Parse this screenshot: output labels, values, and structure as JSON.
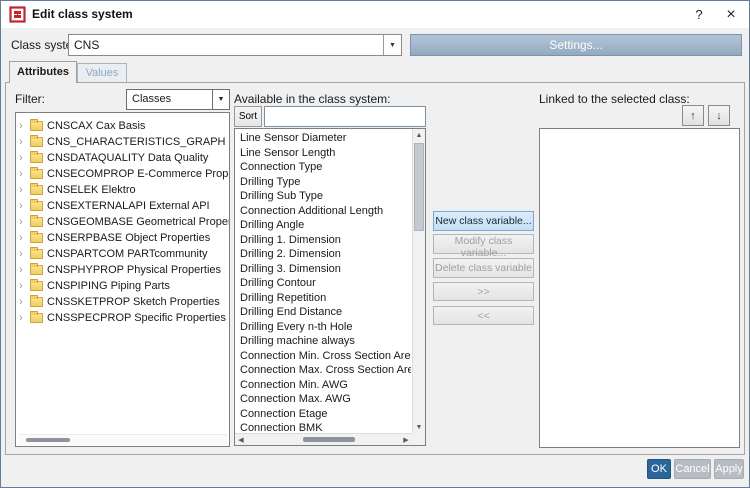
{
  "colors": {
    "accent_blue": "#2a6699",
    "settings_button_blue": "#92aac0",
    "highlight_button_blue": "#c6def5",
    "disabled_text": "#9aa0a5",
    "logo_red": "#c4242b"
  },
  "icons": {
    "dropdown": "▼",
    "scroll_up": "▲",
    "scroll_down": "▼",
    "scroll_left": "◀",
    "scroll_right": "▶"
  },
  "window": {
    "title": "Edit class system",
    "help": "?",
    "close": "×"
  },
  "header": {
    "class_system_label": "Class system:",
    "class_system_value": "CNS",
    "settings_button": "Settings..."
  },
  "tabs": [
    {
      "label": "Attributes",
      "active": true
    },
    {
      "label": "Values",
      "active": false
    }
  ],
  "filter": {
    "label": "Filter:",
    "value": "Classes"
  },
  "tree": {
    "items": [
      "CNSCAX Cax Basis",
      "CNS_CHARACTERISTICS_GRAPH Characte",
      "CNSDATAQUALITY Data Quality",
      "CNSECOMPROP E-Commerce Properties",
      "CNSELEK Elektro",
      "CNSEXTERNALAPI External API",
      "CNSGEOMBASE Geometrical Properties",
      "CNSERPBASE Object Properties",
      "CNSPARTCOM PARTcommunity",
      "CNSPHYPROP Physical Properties",
      "CNSPIPING Piping Parts",
      "CNSSKETPROP Sketch Properties",
      "CNSSPECPROP Specific Properties"
    ]
  },
  "available": {
    "label": "Available in the class system:",
    "sort_button": "Sort",
    "search_value": "",
    "items": [
      "Line Sensor Diameter",
      "Line Sensor Length",
      "Connection Type",
      "Drilling Type",
      "Drilling Sub Type",
      "Connection Additional Length",
      "Drilling Angle",
      "Drilling 1. Dimension",
      "Drilling 2. Dimension",
      "Drilling 3. Dimension",
      "Drilling Contour",
      "Drilling Repetition",
      "Drilling End Distance",
      "Drilling Every n-th Hole",
      "Drilling machine always",
      "Connection Min. Cross Section Area",
      "Connection Max. Cross Section Area",
      "Connection Min. AWG",
      "Connection Max. AWG",
      "Connection Etage",
      "Connection BMK"
    ]
  },
  "actions": {
    "new_button": "New class variable...",
    "modify_button": "Modify class variable...",
    "delete_button": "Delete class variable",
    "add_button": ">>",
    "remove_button": "<<"
  },
  "linked": {
    "label": "Linked to the selected class:",
    "up_button": "↑",
    "down_button": "↓"
  },
  "footer": {
    "ok_button": "OK",
    "cancel_button": "Cancel",
    "apply_button": "Apply"
  }
}
